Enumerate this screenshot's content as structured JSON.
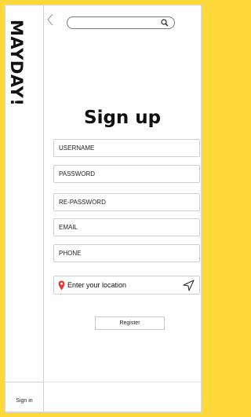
{
  "app": {
    "logo": "MAYDAY!"
  },
  "colors": {
    "background": "#ffd93a",
    "pin": "#e53935"
  },
  "topbar": {
    "back_icon": "chevron-left-icon",
    "search_placeholder": "",
    "search_icon": "search-icon"
  },
  "page": {
    "title": "Sign up"
  },
  "form": {
    "username_placeholder": "USERNAME",
    "password_placeholder": "PASSWORD",
    "repassword_placeholder": "RE-PASSWORD",
    "email_placeholder": "EMAIL",
    "phone_placeholder": "PHONE",
    "location_placeholder": "Enter your location",
    "location_icon": "map-pin-icon",
    "send_icon": "send-location-icon",
    "register_label": "Register"
  },
  "sidebar": {
    "signin_label": "Sign in"
  }
}
